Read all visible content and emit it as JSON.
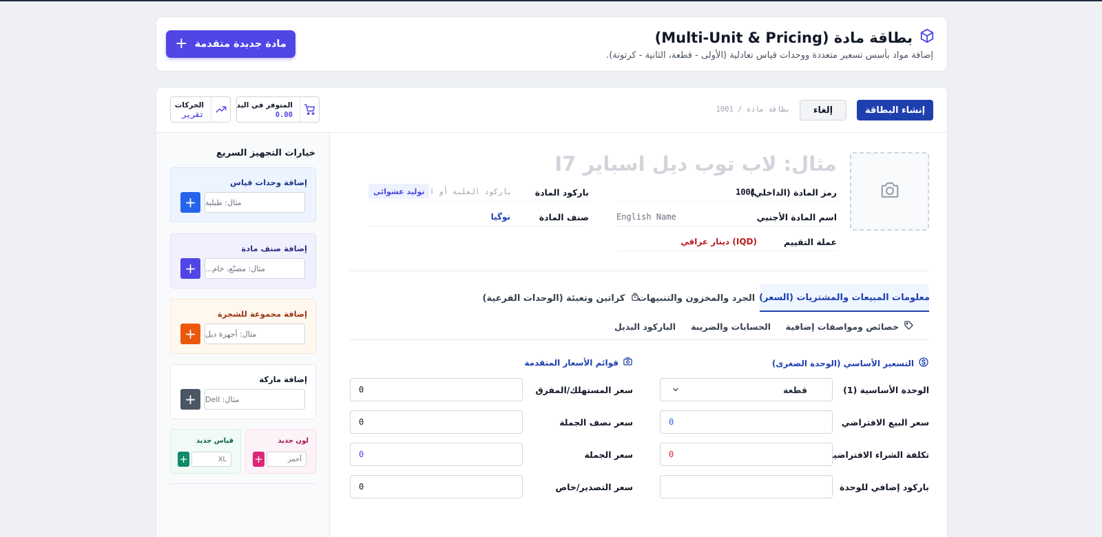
{
  "header": {
    "title": "بطاقة مادة (Multi-Unit & Pricing)",
    "subtitle": "إضافة مواد بأسس تسعير متعددة ووحدات قياس تعادلية (الأولى - قطعة، الثانية - كرتونة).",
    "new_item_button": "مادة جديدة متقدمة",
    "title_icon": "cube-icon"
  },
  "toolbar": {
    "create_button": "إنشاء البطاقة",
    "cancel_button": "إلغاء",
    "breadcrumb": "بطاقة مادة / 1001",
    "stock": {
      "label": "المتوفر في اليد",
      "value": "0.00",
      "icon": "cart-icon"
    },
    "movements": {
      "label": "الحركات",
      "value": "تقرير",
      "icon": "trending-up-icon"
    }
  },
  "sidebar": {
    "title": "خيارات التجهيز السريع",
    "boxes": [
      {
        "title": "إضافة وحدات قياس",
        "placeholder": "مثال: طبلية",
        "color": "#2563eb"
      },
      {
        "title": "إضافة صنف مادة",
        "placeholder": "مثال: مصنّع، خام...",
        "color": "#4f46e5"
      },
      {
        "title": "إضافة مجموعة للشجرة",
        "placeholder": "مثال: أجهزة ديل",
        "color": "#ea580c"
      },
      {
        "title": "إضافة ماركة",
        "placeholder": "مثال: Dell",
        "color": "#4b5563"
      }
    ],
    "small_boxes": [
      {
        "title": "لون جديد",
        "placeholder": "أحمر",
        "color": "#db2777"
      },
      {
        "title": "قياس جديد",
        "placeholder": "XL",
        "color": "#0f8a6a"
      }
    ]
  },
  "item": {
    "name_placeholder": "مثال: لاب توب ديل اسباير I7",
    "code_label": "رمز المادة (الداخلي)",
    "code_value": "1001",
    "barcode_label": "باركود المادة",
    "barcode_placeholder": "باركود العلبة أو ال",
    "barcode_generate": "توليد عشوائي",
    "foreign_name_label": "اسم المادة الأجنبي",
    "foreign_name_placeholder": "English Name",
    "category_label": "صنف المادة",
    "category_value": "نوگيا",
    "currency_label": "عملة التقييم",
    "currency_value": "دينار عراقي (IQD)"
  },
  "tabs": [
    {
      "label": "معلومات المبيعات والمشتريات (السعر)",
      "active": true
    },
    {
      "label": "الجرد والمخزون والتنبيهات",
      "active": false
    },
    {
      "label": "كراتين وتعبئة (الوحدات الفرعية)",
      "active": false,
      "icon": "package-icon"
    }
  ],
  "subtabs": [
    {
      "label": "خصائص ومواصفات إضافية",
      "icon": "tag-icon"
    },
    {
      "label": "الحسابات والضريبة"
    },
    {
      "label": "الباركود البديل"
    }
  ],
  "pricing": {
    "basic_title": "التسعير الأساسي (الوحدة الصغرى)",
    "advanced_title": "قوائم الأسعار المتقدمة",
    "base_unit_label": "الوحدة الأساسية (1)",
    "base_unit_value": "قطعة",
    "default_sale_label": "سعر البيع الافتراضي",
    "default_sale_value": "0",
    "default_cost_label": "تكلفة الشراء الافتراضية",
    "default_cost_value": "0",
    "extra_barcode_label": "باركود إضافي للوحدة",
    "extra_barcode_value": "",
    "consumer_label": "سعر المستهلك/المفرق",
    "consumer_value": "0",
    "half_wholesale_label": "سعر نصف الجملة",
    "half_wholesale_value": "0",
    "wholesale_label": "سعر الجملة",
    "wholesale_value": "0",
    "export_label": "سعر التصدير/خاص",
    "export_value": "0"
  },
  "colors": {
    "primary": "#4f46e5",
    "accent_blue": "#1e40af",
    "currency_red": "#b91c1c",
    "cost_red": "#dc2626"
  }
}
